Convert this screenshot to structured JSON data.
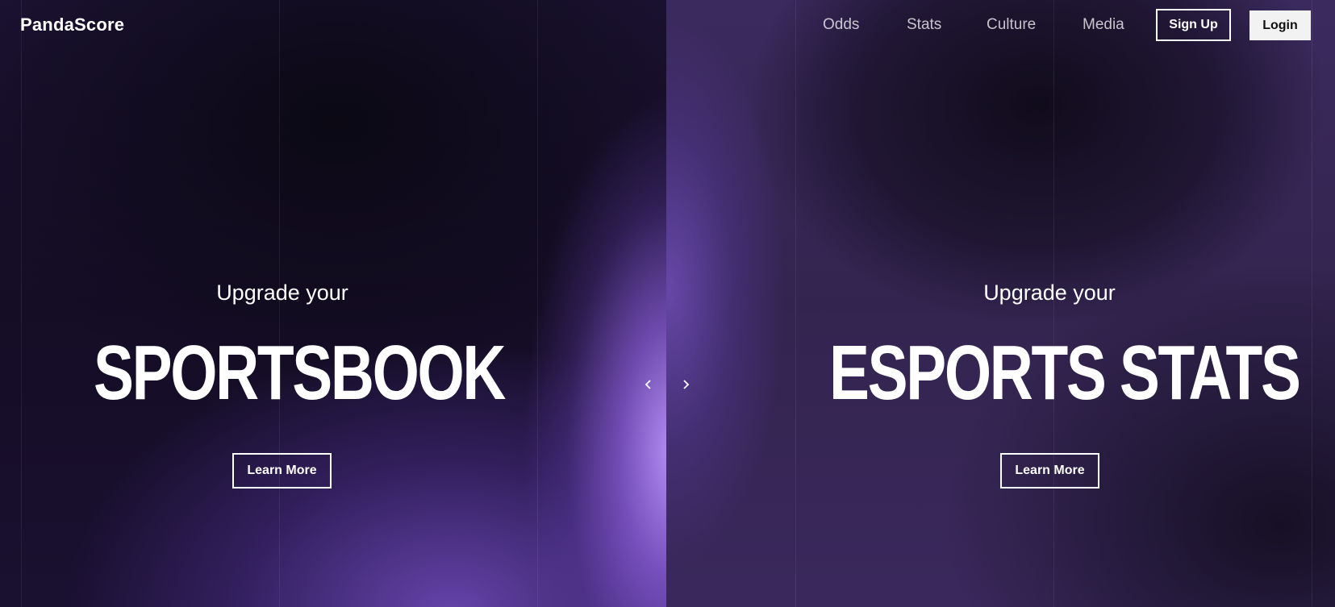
{
  "header": {
    "logo": "PandaScore",
    "nav": [
      "Odds",
      "Stats",
      "Culture",
      "Media"
    ],
    "signup_label": "Sign Up",
    "login_label": "Login"
  },
  "slides": [
    {
      "subtitle": "Upgrade your",
      "title": "SPORTSBOOK",
      "cta": "Learn More"
    },
    {
      "subtitle": "Upgrade your",
      "title": "ESPORTS STATS",
      "cta": "Learn More"
    }
  ],
  "carousel": {
    "prev_icon": "chevron-left-icon",
    "next_icon": "chevron-right-icon"
  },
  "colors": {
    "accent": "#8f6bd8",
    "background": "#140d22"
  }
}
